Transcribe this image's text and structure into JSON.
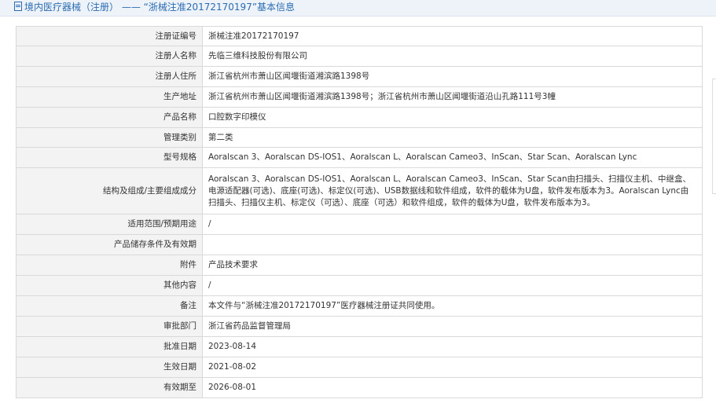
{
  "header": {
    "title": "境内医疗器械（注册） —— “浙械注准20172170197”基本信息"
  },
  "rows": [
    {
      "label": "注册证编号",
      "value": "浙械注准20172170197"
    },
    {
      "label": "注册人名称",
      "value": "先临三维科技股份有限公司"
    },
    {
      "label": "注册人住所",
      "value": "浙江省杭州市萧山区闻堰街道湘滨路1398号"
    },
    {
      "label": "生产地址",
      "value": "浙江省杭州市萧山区闻堰街道湘滨路1398号；浙江省杭州市萧山区闻堰街道沿山孔路111号3幢"
    },
    {
      "label": "产品名称",
      "value": "口腔数字印模仪"
    },
    {
      "label": "管理类别",
      "value": "第二类"
    },
    {
      "label": "型号规格",
      "value": "Aoralscan 3、Aoralscan DS-IOS1、Aoralscan L、Aoralscan Cameo3、InScan、Star Scan、Aoralscan Lync"
    },
    {
      "label": "结构及组成/主要组成成分",
      "value": "Aoralscan 3、Aoralscan DS-IOS1、Aoralscan L、Aoralscan Cameo3、InScan、Star Scan由扫描头、扫描仪主机、中继盒、电源适配器(可选)、底座(可选)、标定仪(可选)、USB数据线和软件组成，软件的载体为U盘，软件发布版本为3。Aoralscan Lync由扫描头、扫描仪主机、标定仪（可选）、底座（可选）和软件组成，软件的载体为U盘，软件发布版本为3。"
    },
    {
      "label": "适用范围/预期用途",
      "value": "/"
    },
    {
      "label": "产品储存条件及有效期",
      "value": ""
    },
    {
      "label": "附件",
      "value": "产品技术要求"
    },
    {
      "label": "其他内容",
      "value": "/"
    },
    {
      "label": "备注",
      "value": "本文件与“浙械注准20172170197”医疗器械注册证共同使用。"
    },
    {
      "label": "审批部门",
      "value": "浙江省药品监督管理局"
    },
    {
      "label": "批准日期",
      "value": "2023-08-14"
    },
    {
      "label": "生效日期",
      "value": "2021-08-02"
    },
    {
      "label": "有效期至",
      "value": "2026-08-01"
    }
  ]
}
